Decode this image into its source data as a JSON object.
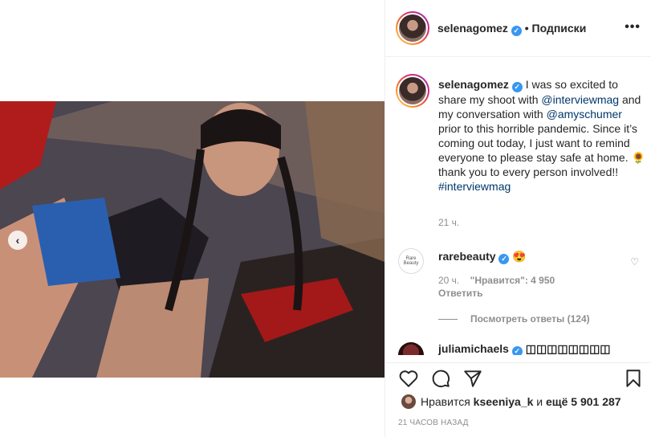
{
  "post": {
    "media": {
      "image_alt": "photo",
      "prev_arrow_icon": "chevron-left-icon"
    },
    "header": {
      "username": "selenagomez",
      "verified_icon": "verified-badge-icon",
      "separator": "•",
      "follow_label": "Подписки",
      "more_icon": "more-options-icon"
    },
    "caption": {
      "username": "selenagomez",
      "text_1": " I was so excited to share my shoot with ",
      "mention_1": "@interviewmag",
      "text_2": " and my conversation with ",
      "mention_2": "@amyschumer",
      "text_3": " prior to this horrible pandemic. Since it’s coming out today, I just want to remind everyone to please stay safe at home. 🌻 thank you to every person involved!! ",
      "hashtag": "#interviewmag",
      "time": "21 ч."
    },
    "comments": [
      {
        "avatar_label": "Rare Beauty",
        "username": "rarebeauty",
        "text": " 😍",
        "time": "20 ч.",
        "likes_label": "\"Нравится\": 4 950",
        "reply_label": "Ответить",
        "view_replies": "Посмотреть ответы (124)"
      },
      {
        "username": "juliamichaels",
        "text": " ◫◫◫◫◫◫◫◫"
      }
    ],
    "actions": {
      "like_icon": "heart-icon",
      "comment_icon": "comment-icon",
      "share_icon": "share-icon",
      "save_icon": "bookmark-icon"
    },
    "likes": {
      "prefix": "Нравится ",
      "user": "kseeniya_k",
      "middle": " и ",
      "count": "ещё 5 901 287"
    },
    "timestamp": "21 часов назад"
  },
  "colors": {
    "link": "#00376b",
    "muted": "#8e8e8e",
    "verified": "#3897f0",
    "border": "#efefef"
  }
}
